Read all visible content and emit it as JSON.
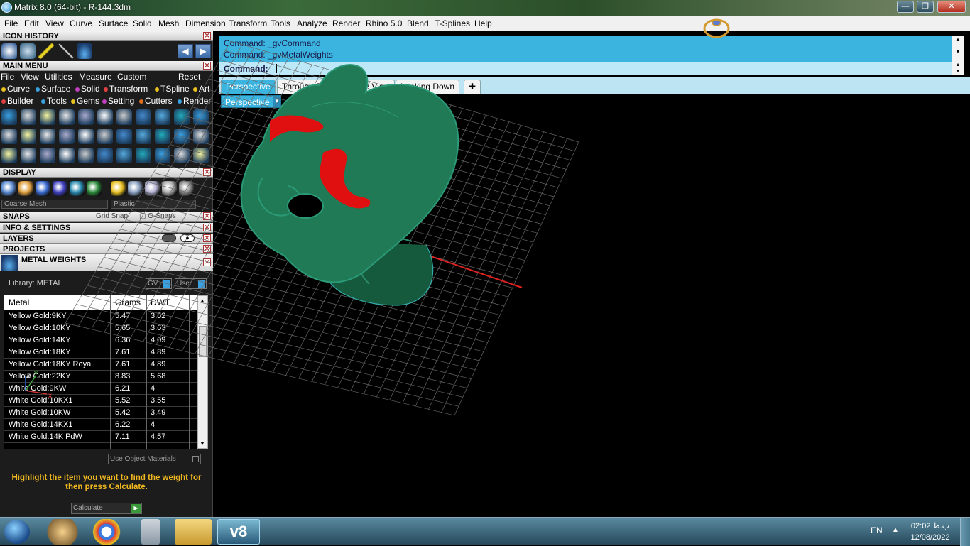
{
  "window": {
    "title": "Matrix 8.0 (64-bit) - R-144.3dm",
    "buttons": [
      "—",
      "❐",
      "✕"
    ]
  },
  "menubar": [
    "File",
    "Edit",
    "View",
    "Curve",
    "Surface",
    "Solid",
    "Mesh",
    "Dimension",
    "Transform",
    "Tools",
    "Analyze",
    "Render",
    "Rhino 5.0",
    "Blend",
    "T-Splines",
    "Help"
  ],
  "panels": {
    "icon_history": "ICON HISTORY",
    "main_menu": "MAIN MENU",
    "display": "DISPLAY",
    "snaps": "SNAPS",
    "grid_snap": "Grid Snap",
    "osnaps": "O-Snaps",
    "info": "INFO & SETTINGS",
    "layers": "LAYERS",
    "projects": "PROJECTS",
    "metal_weights": "METAL WEIGHTS"
  },
  "main_menu_items": [
    "File",
    "View",
    "Utilities",
    "Measure",
    "Custom"
  ],
  "main_menu_reset": "Reset",
  "categories_row1": [
    {
      "label": "Curve",
      "color": "#e8c020"
    },
    {
      "label": "Surface",
      "color": "#3aa0e0"
    },
    {
      "label": "Solid",
      "color": "#c040c0"
    },
    {
      "label": "Transform",
      "color": "#e04040"
    },
    {
      "label": "TSpline",
      "color": "#e8c020"
    },
    {
      "label": "Art",
      "color": "#e8c020"
    }
  ],
  "categories_row2": [
    {
      "label": "Builder",
      "color": "#e04040"
    },
    {
      "label": "Tools",
      "color": "#3aa0e0"
    },
    {
      "label": "Gems",
      "color": "#e8c020"
    },
    {
      "label": "Setting",
      "color": "#c040c0"
    },
    {
      "label": "Cutters",
      "color": "#e07020"
    },
    {
      "label": "Render",
      "color": "#3aa0e0"
    }
  ],
  "display": {
    "mesh": "Coarse Mesh",
    "material": "Plastic"
  },
  "metal": {
    "library": "Library: METAL",
    "gv": "GV",
    "user": "User",
    "columns": [
      "Metal",
      "Grams",
      "DWT"
    ],
    "rows": [
      [
        "Yellow Gold:9KY",
        "5.47",
        "3.52"
      ],
      [
        "Yellow Gold:10KY",
        "5.65",
        "3.63"
      ],
      [
        "Yellow Gold:14KY",
        "6.36",
        "4.09"
      ],
      [
        "Yellow Gold:18KY",
        "7.61",
        "4.89"
      ],
      [
        "Yellow Gold:18KY Royal",
        "7.61",
        "4.89"
      ],
      [
        "Yellow Gold:22KY",
        "8.83",
        "5.68"
      ],
      [
        "White Gold:9KW",
        "6.21",
        "4"
      ],
      [
        "White Gold:10KX1",
        "5.52",
        "3.55"
      ],
      [
        "White Gold:10KW",
        "5.42",
        "3.49"
      ],
      [
        "White Gold:14KX1",
        "6.22",
        "4"
      ],
      [
        "White Gold:14K PdW",
        "7.11",
        "4.57"
      ]
    ],
    "use_object_materials": "Use Object Materials",
    "hint": "Highlight the item you want to find the weight for then press Calculate.",
    "calculate": "Calculate"
  },
  "command": {
    "history": [
      "Command: _gvCommand",
      "Command: _gvMetalWeights"
    ],
    "prompt": "Command:"
  },
  "view_tabs": [
    "Perspective",
    "Through Finger",
    "Side View",
    "Looking Down"
  ],
  "active_view": "Perspective",
  "viewport_label": "Perspective",
  "axis": {
    "x": "x",
    "y": "y",
    "z": "z"
  },
  "taskbar": {
    "lang": "EN",
    "time": "02:02 ب.ظ",
    "date": "12/08/2022"
  },
  "colors": {
    "ring_green": "#1f7a55",
    "highlight_red": "#e01010",
    "cmd_blue": "#3bb5e0"
  }
}
